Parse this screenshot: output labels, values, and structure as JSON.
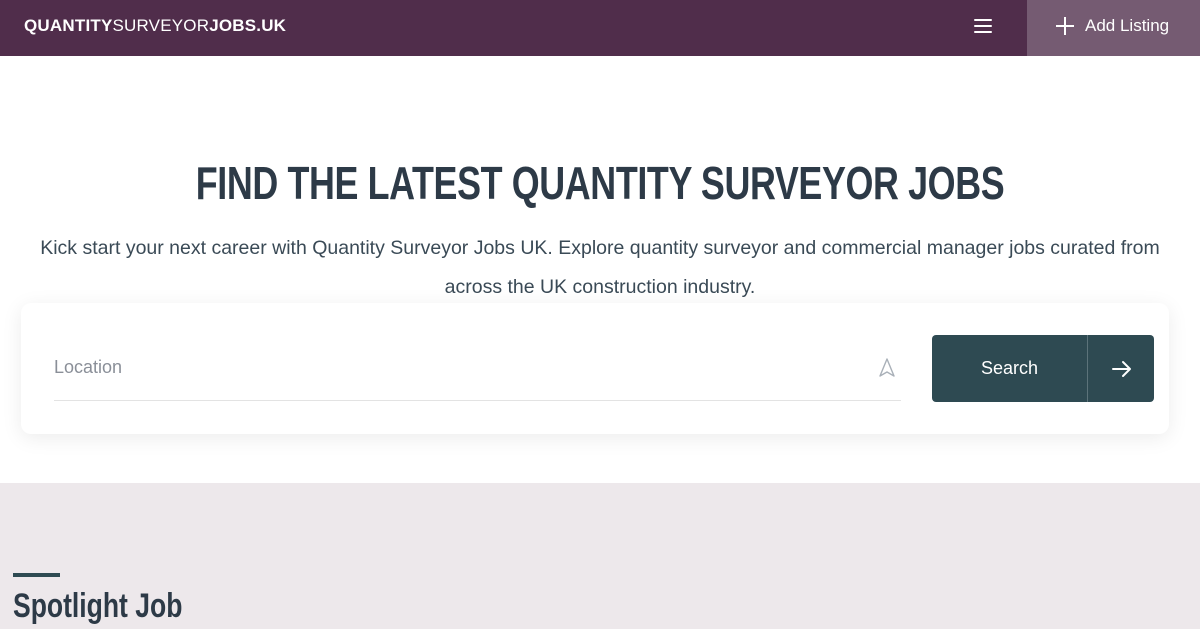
{
  "header": {
    "logo_part1": "QUANTITY",
    "logo_part2": "SURVEYOR",
    "logo_part3": "JOBS.UK",
    "add_listing_label": "Add Listing"
  },
  "hero": {
    "title": "FIND THE LATEST QUANTITY SURVEYOR JOBS",
    "subtitle": "Kick start your next career with Quantity Surveyor Jobs UK. Explore quantity surveyor and commercial manager jobs curated from across the UK construction industry."
  },
  "search": {
    "location_placeholder": "Location",
    "location_value": "",
    "search_label": "Search"
  },
  "spotlight": {
    "title": "Spotlight Job"
  },
  "colors": {
    "header_bg": "#502d4b",
    "add_listing_bg": "#755b72",
    "button_bg": "#2e4a52",
    "section_bg": "#ede8eb"
  },
  "icons": {
    "menu": "hamburger-menu-icon",
    "add": "plus-icon",
    "locate": "navigation-arrow-icon",
    "go": "arrow-right-icon"
  }
}
